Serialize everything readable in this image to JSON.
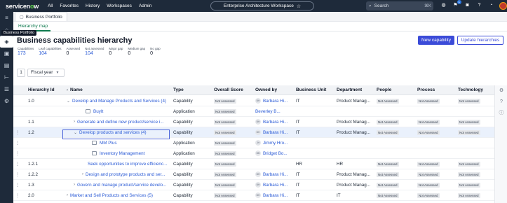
{
  "topbar": {
    "logo_pre": "service",
    "logo_o": "n",
    "logo_post": "w",
    "nav": [
      "All",
      "Favorites",
      "History",
      "Workspaces",
      "Admin"
    ],
    "workspace": "Enterprise Architecture Workspace",
    "search_placeholder": "Search",
    "search_shortcut": "⌘K",
    "notification_count": "1"
  },
  "sidebar": {
    "tooltip": "Business Portfolio"
  },
  "tabs": {
    "main": "Business Portfolio",
    "sub": "Hierarchy map"
  },
  "page": {
    "title": "Business capabilities hierarchy",
    "new_button": "New capability",
    "update_button": "Update hierarchies"
  },
  "stats": [
    {
      "label": "Capabilities",
      "value": "173",
      "link": true
    },
    {
      "label": "Leaf capabilities",
      "value": "104",
      "link": true
    },
    {
      "label": "Assessed",
      "value": "0",
      "link": false
    },
    {
      "label": "Not assessed",
      "value": "104",
      "link": true
    },
    {
      "label": "Major gap",
      "value": "0",
      "link": false
    },
    {
      "label": "Medium gap",
      "value": "0",
      "link": false
    },
    {
      "label": "No gap",
      "value": "0",
      "link": false
    }
  ],
  "fiscal": {
    "number": "1",
    "label": "Fiscal year"
  },
  "grid": {
    "headers": {
      "id": "Hierarchy Id",
      "name": "Name",
      "type": "Type",
      "score": "Overall Score",
      "owner": "Owned by",
      "bu": "Business Unit",
      "dept": "Department",
      "people": "People",
      "process": "Process",
      "tech": "Technology"
    },
    "rows": [
      {
        "id": "1.0",
        "name": "Develop and Manage Products and Services (4)",
        "type": "Capability",
        "score": "Not Assessed",
        "owner_initials": "BH",
        "owner": "Barbara Hi...",
        "bu": "IT",
        "dept": "Product Manag...",
        "people": "Not Assessed",
        "process": "Not Assessed",
        "tech": "Not Assessed"
      },
      {
        "id": "",
        "name": "BuyIt",
        "type": "Application",
        "score": "Not Assessed",
        "owner_initials": "",
        "owner": "Beverley B...",
        "bu": "",
        "dept": "",
        "people": "",
        "process": "",
        "tech": ""
      },
      {
        "id": "1.1",
        "name": "Generate and define new product/service i...",
        "type": "Capability",
        "score": "Not Assessed",
        "owner_initials": "BH",
        "owner": "Barbara Hi...",
        "bu": "IT",
        "dept": "Product Manag...",
        "people": "Not Assessed",
        "process": "Not Assessed",
        "tech": "Not Assessed"
      },
      {
        "id": "1.2",
        "name": "Develop products and services (4)",
        "type": "Capability",
        "score": "Not Assessed",
        "owner_initials": "BH",
        "owner": "Barbara Hi...",
        "bu": "IT",
        "dept": "Product Manag...",
        "people": "Not Assessed",
        "process": "Not Assessed",
        "tech": "Not Assessed"
      },
      {
        "id": "",
        "name": "MM Plus",
        "type": "Application",
        "score": "Not Assessed",
        "owner_initials": "JH",
        "owner": "Jimmy Hro...",
        "bu": "",
        "dept": "",
        "people": "",
        "process": "",
        "tech": ""
      },
      {
        "id": "",
        "name": "Inventory Management",
        "type": "Application",
        "score": "Not Assessed",
        "owner_initials": "BB",
        "owner": "Bridget Bo...",
        "bu": "",
        "dept": "",
        "people": "",
        "process": "",
        "tech": ""
      },
      {
        "id": "1.2.1",
        "name": "Seek opportunities to improve efficienc...",
        "type": "Capability",
        "score": "Not Assessed",
        "owner_initials": "",
        "owner": "",
        "bu": "HR",
        "dept": "HR",
        "people": "Not Assessed",
        "process": "Not Assessed",
        "tech": "Not Assessed"
      },
      {
        "id": "1.2.2",
        "name": "Design and prototype products and ser...",
        "type": "Capability",
        "score": "Not Assessed",
        "owner_initials": "BH",
        "owner": "Barbara Hi...",
        "bu": "IT",
        "dept": "Product Manag...",
        "people": "Not Assessed",
        "process": "Not Assessed",
        "tech": "Not Assessed"
      },
      {
        "id": "1.3",
        "name": "Govern and manage product/service develo...",
        "type": "Capability",
        "score": "Not Assessed",
        "owner_initials": "BH",
        "owner": "Barbara Hi...",
        "bu": "IT",
        "dept": "Product Manag...",
        "people": "Not Assessed",
        "process": "Not Assessed",
        "tech": "Not Assessed"
      },
      {
        "id": "2.0",
        "name": "Market and Sell Products and Services (5)",
        "type": "Capability",
        "score": "Not Assessed",
        "owner_initials": "BH",
        "owner": "Barbara Hi...",
        "bu": "IT",
        "dept": "IT",
        "people": "Not Assessed",
        "process": "Not Assessed",
        "tech": "Not Assessed"
      }
    ]
  }
}
